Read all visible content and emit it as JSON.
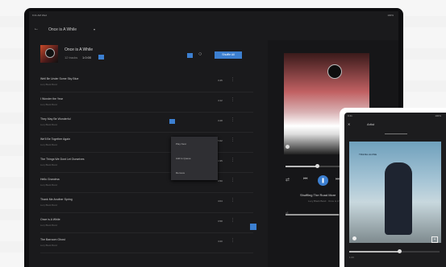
{
  "colors": {
    "accent": "#3c7fd0",
    "background": "#1a1a1c",
    "panel": "#161618"
  },
  "status_bar": {
    "time": "9:41 AM Wed",
    "battery": "100%"
  },
  "header": {
    "breadcrumb": "Once is A While",
    "back_icon": "back-arrow-icon"
  },
  "playlist": {
    "title": "Once is A While",
    "subtitle": "12 tracks",
    "count": "1:0:00",
    "shuffle_label": "Shuffle All"
  },
  "tracks": [
    {
      "title": "Well Be Under Some Sky Blue",
      "artist": "Lucy Black Band",
      "duration": "3:45"
    },
    {
      "title": "I Wonder the Year",
      "artist": "Lucy Black Band",
      "duration": "4:12"
    },
    {
      "title": "They May Be Wonderful",
      "artist": "Lucy Black Band",
      "duration": "3:28"
    },
    {
      "title": "We'll Be Together Again",
      "artist": "Lucy Black Band",
      "duration": "5:02"
    },
    {
      "title": "The Things We Dont Let Ourselves",
      "artist": "Lucy Black Band",
      "duration": "4:35"
    },
    {
      "title": "Hello Grandma",
      "artist": "Lucy Black Band",
      "duration": "3:50"
    },
    {
      "title": "Thank Me Another Spring",
      "artist": "Lucy Black Band",
      "duration": "4:04"
    },
    {
      "title": "Once is A While",
      "artist": "Lucy Black Band",
      "duration": "3:58"
    },
    {
      "title": "The Barroom Ghost",
      "artist": "Lucy Black Band",
      "duration": "4:20"
    }
  ],
  "context_menu": {
    "items": [
      "Play Next",
      "Add to Queue",
      "Remove"
    ]
  },
  "now_playing": {
    "title": "Shuffling The Road More",
    "artist": "Lucy Black Band · Once is A While",
    "progress": 0.35,
    "volume": 0.6
  },
  "phone": {
    "time": "9:41",
    "battery": "100%",
    "header": "Artist",
    "progress": 0.55,
    "time_elapsed": "1:23",
    "cover_text": "TRAVEL ALONE"
  }
}
